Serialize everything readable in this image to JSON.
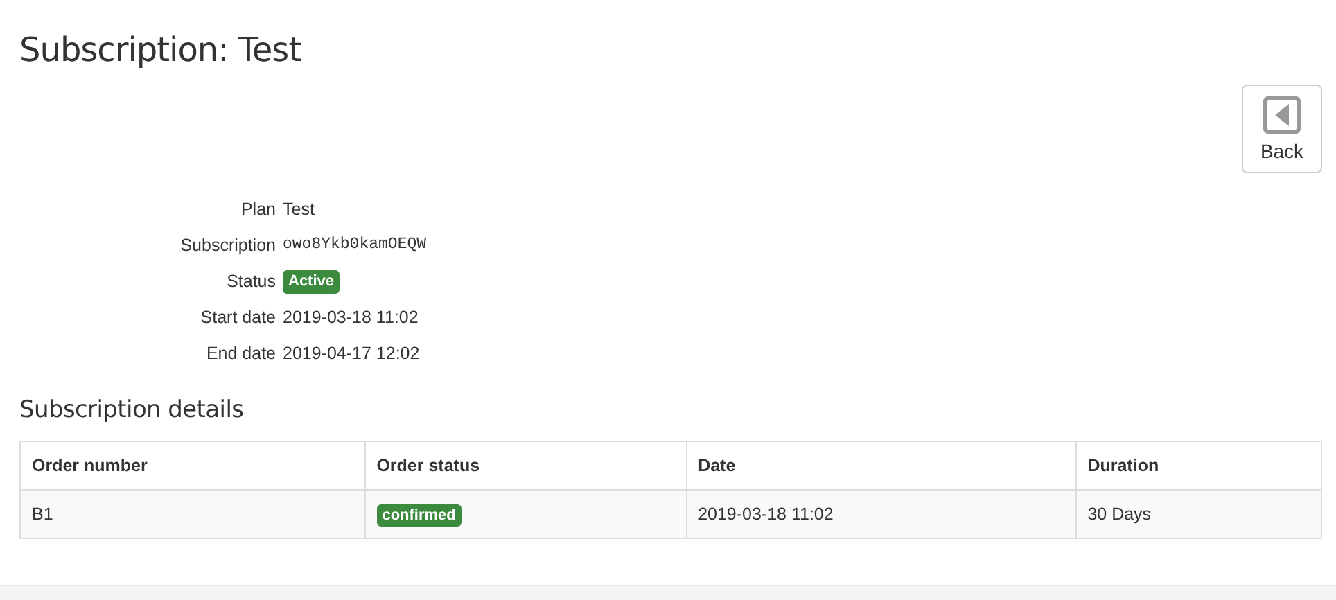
{
  "title": "Subscription: Test",
  "back_button": {
    "label": "Back"
  },
  "details": [
    {
      "label": "Plan",
      "value": "Test",
      "kind": "text"
    },
    {
      "label": "Subscription",
      "value": "owo8Ykb0kamOEQW",
      "kind": "code"
    },
    {
      "label": "Status",
      "value": "Active",
      "kind": "badge"
    },
    {
      "label": "Start date",
      "value": "2019-03-18 11:02",
      "kind": "text"
    },
    {
      "label": "End date",
      "value": "2019-04-17 12:02",
      "kind": "text"
    }
  ],
  "section_title": "Subscription details",
  "table": {
    "columns": [
      "Order number",
      "Order status",
      "Date",
      "Duration"
    ],
    "rows": [
      {
        "order_number": "B1",
        "order_status": "confirmed",
        "date": "2019-03-18 11:02",
        "duration": "30 Days"
      }
    ]
  }
}
